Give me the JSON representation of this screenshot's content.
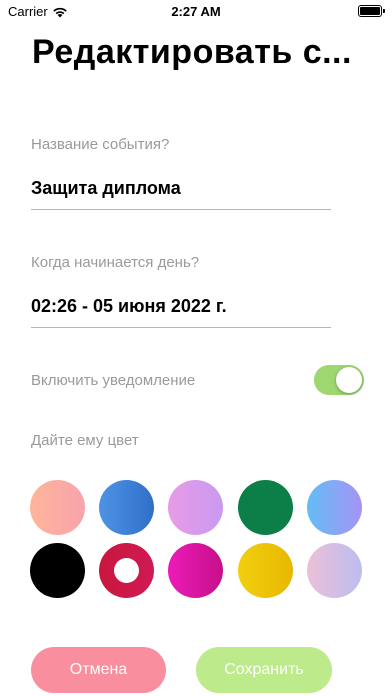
{
  "status_bar": {
    "carrier": "Carrier",
    "time": "2:27 AM"
  },
  "title": "Редактировать с...",
  "event_name": {
    "label": "Название события?",
    "value": "Защита диплома"
  },
  "start_date": {
    "label": "Когда начинается день?",
    "value": "02:26 - 05 июня 2022 г."
  },
  "notification": {
    "label": "Включить уведомление",
    "enabled": true,
    "accent": "#9ed66f"
  },
  "color_picker": {
    "label": "Дайте ему цвет",
    "colors": [
      {
        "name": "peach",
        "gradient": [
          "#ffb59a",
          "#f7a3ac"
        ]
      },
      {
        "name": "blue",
        "gradient": [
          "#4f93e6",
          "#2f6fc8"
        ]
      },
      {
        "name": "violet-pink",
        "gradient": [
          "#e89be6",
          "#c99af0"
        ]
      },
      {
        "name": "green",
        "gradient": [
          "#0b7f47",
          "#0b7f47"
        ]
      },
      {
        "name": "sky-lavender",
        "gradient": [
          "#63bdf6",
          "#a793f4"
        ]
      },
      {
        "name": "black",
        "gradient": [
          "#000000",
          "#000000"
        ]
      },
      {
        "name": "crimson",
        "gradient": [
          "#c8173d",
          "#d01a55"
        ],
        "selected": true
      },
      {
        "name": "magenta",
        "gradient": [
          "#ec1bb8",
          "#c6108a"
        ]
      },
      {
        "name": "yellow",
        "gradient": [
          "#f2cf10",
          "#e7b800"
        ]
      },
      {
        "name": "pastel-pink-lavender",
        "gradient": [
          "#ecc0d8",
          "#bcbdf0"
        ]
      }
    ]
  },
  "buttons": {
    "cancel": "Отмена",
    "save": "Сохранить"
  }
}
